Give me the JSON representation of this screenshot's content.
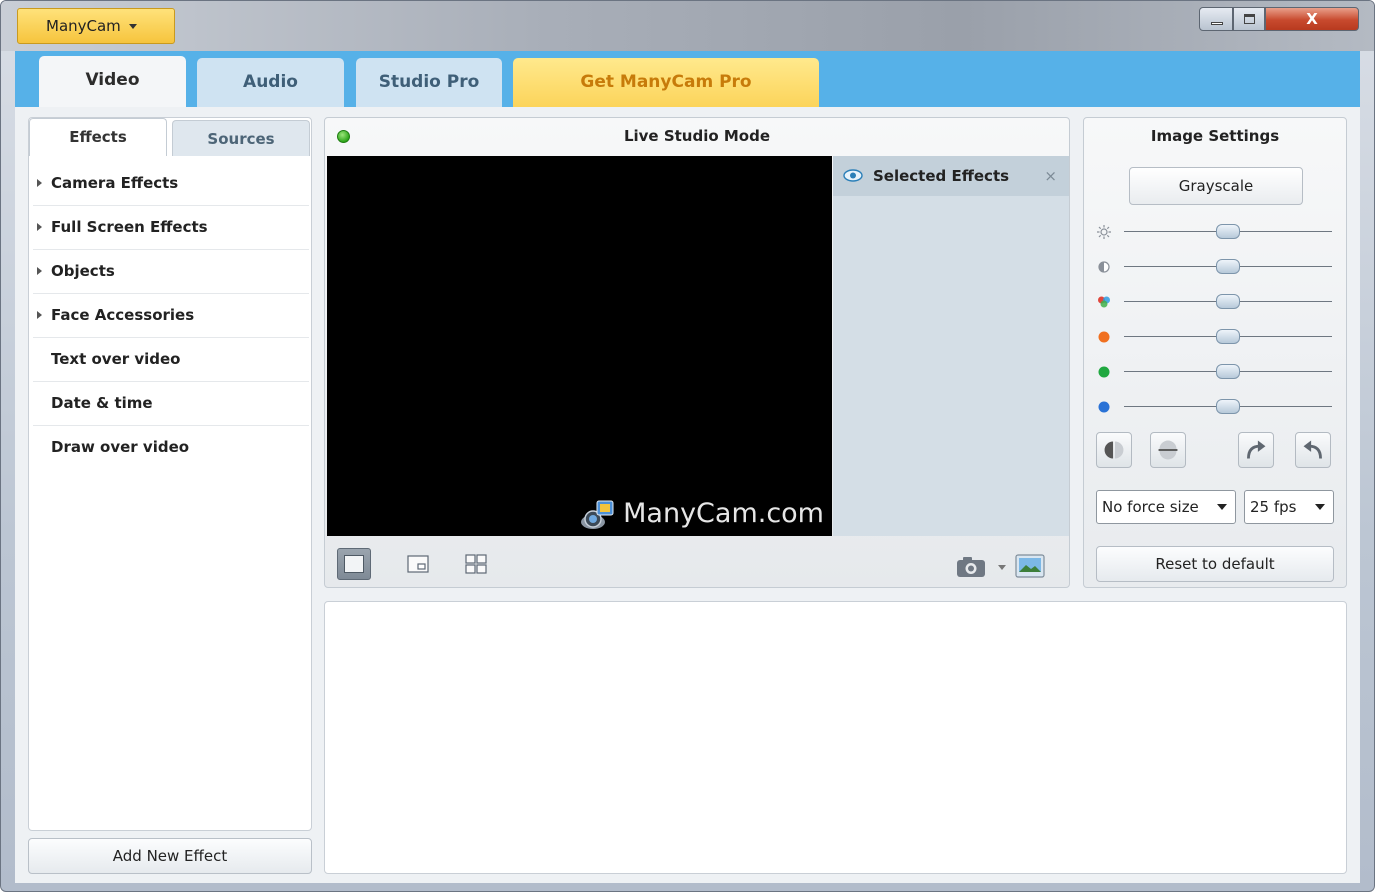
{
  "app_menu": {
    "label": "ManyCam"
  },
  "window_controls": {
    "close_label": "X"
  },
  "main_tabs": [
    {
      "label": "Video",
      "active": true
    },
    {
      "label": "Audio",
      "active": false
    },
    {
      "label": "Studio Pro",
      "active": false
    },
    {
      "label": "Get ManyCam Pro",
      "active": false
    }
  ],
  "left_panel": {
    "subtabs": [
      {
        "label": "Effects",
        "active": true
      },
      {
        "label": "Sources",
        "active": false
      }
    ],
    "effects": [
      {
        "label": "Camera Effects",
        "expandable": true
      },
      {
        "label": "Full Screen Effects",
        "expandable": true
      },
      {
        "label": "Objects",
        "expandable": true
      },
      {
        "label": "Face Accessories",
        "expandable": true
      },
      {
        "label": "Text over video",
        "expandable": false
      },
      {
        "label": "Date & time",
        "expandable": false
      },
      {
        "label": "Draw over video",
        "expandable": false
      }
    ],
    "add_button": "Add New Effect"
  },
  "live_studio": {
    "title": "Live Studio Mode",
    "watermark": "ManyCam.com",
    "selected_effects": {
      "title": "Selected Effects",
      "close": "×"
    }
  },
  "image_settings": {
    "title": "Image Settings",
    "grayscale_button": "Grayscale",
    "sliders": [
      {
        "icon": "brightness-icon",
        "value": 0.5
      },
      {
        "icon": "contrast-icon",
        "value": 0.5
      },
      {
        "icon": "saturation-icon",
        "value": 0.5
      },
      {
        "icon": "red-channel-icon",
        "value": 0.5,
        "color": "#f07020"
      },
      {
        "icon": "green-channel-icon",
        "value": 0.5,
        "color": "#20a840"
      },
      {
        "icon": "blue-channel-icon",
        "value": 0.5,
        "color": "#2a72d6"
      }
    ],
    "force_size": "No force size",
    "fps": "25 fps",
    "reset_button": "Reset to default"
  },
  "colors": {
    "tab_bar": "#56b1e8",
    "pro_tab": "#fcd45a",
    "pro_text": "#c77b0a",
    "live_indicator": "#2fa61b"
  }
}
